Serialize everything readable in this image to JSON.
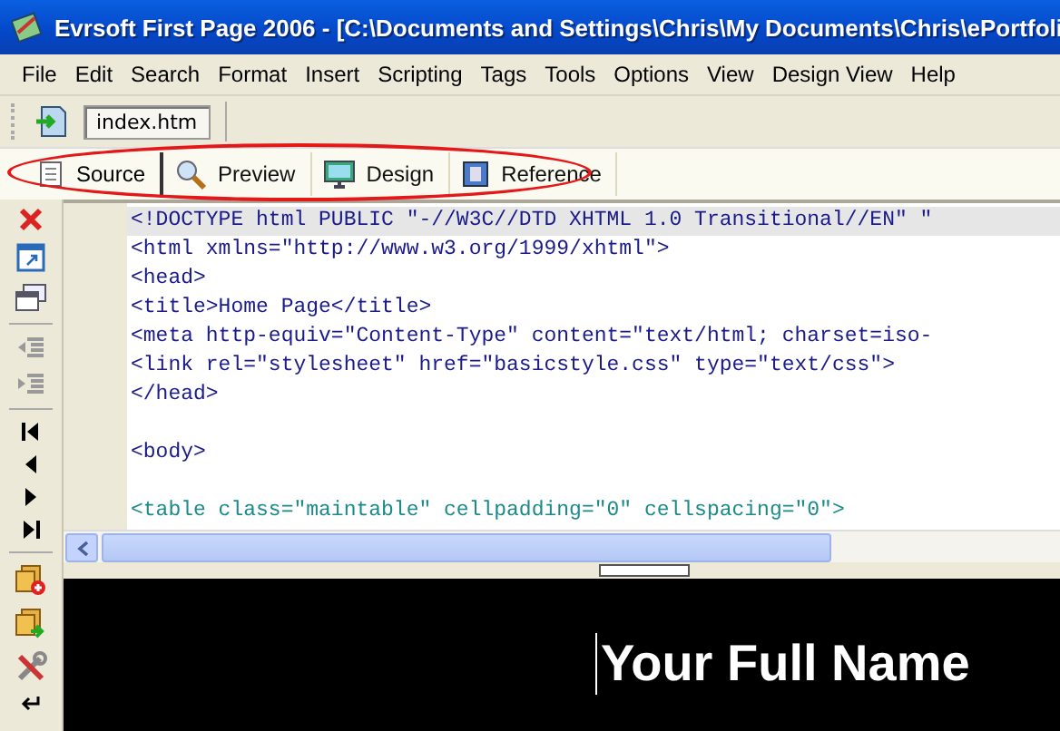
{
  "window": {
    "title": "Evrsoft First Page 2006 - [C:\\Documents and Settings\\Chris\\My Documents\\Chris\\ePortfoli"
  },
  "menu": [
    "File",
    "Edit",
    "Search",
    "Format",
    "Insert",
    "Scripting",
    "Tags",
    "Tools",
    "Options",
    "View",
    "Design View",
    "Help"
  ],
  "file_tabs": [
    {
      "label": "index.htm",
      "selected": true
    }
  ],
  "view_tabs": [
    {
      "label": "Source",
      "selected": true
    },
    {
      "label": "Preview",
      "selected": false
    },
    {
      "label": "Design",
      "selected": false
    },
    {
      "label": "Reference",
      "selected": false
    }
  ],
  "editor": {
    "lines": [
      {
        "text": "<!DOCTYPE html PUBLIC \"-//W3C//DTD XHTML 1.0 Transitional//EN\" \"",
        "current": true,
        "kind": "markup"
      },
      {
        "text": "<html xmlns=\"http://www.w3.org/1999/xhtml\">",
        "current": false,
        "kind": "markup"
      },
      {
        "text": "<head>",
        "current": false,
        "kind": "markup"
      },
      {
        "text": "<title>Home Page</title>",
        "current": false,
        "kind": "markup"
      },
      {
        "text": "<meta http-equiv=\"Content-Type\" content=\"text/html; charset=iso-",
        "current": false,
        "kind": "markup"
      },
      {
        "text": "<link rel=\"stylesheet\" href=\"basicstyle.css\" type=\"text/css\">",
        "current": false,
        "kind": "markup"
      },
      {
        "text": "</head>",
        "current": false,
        "kind": "markup"
      },
      {
        "current": false,
        "kind": "blank"
      },
      {
        "text": "<body>",
        "current": false,
        "kind": "markup"
      },
      {
        "current": false,
        "kind": "blank"
      },
      {
        "text": "<table class=\"maintable\" cellpadding=\"0\" cellspacing=\"0\">",
        "current": false,
        "kind": "table"
      }
    ]
  },
  "preview": {
    "heading": "Your Full Name"
  }
}
